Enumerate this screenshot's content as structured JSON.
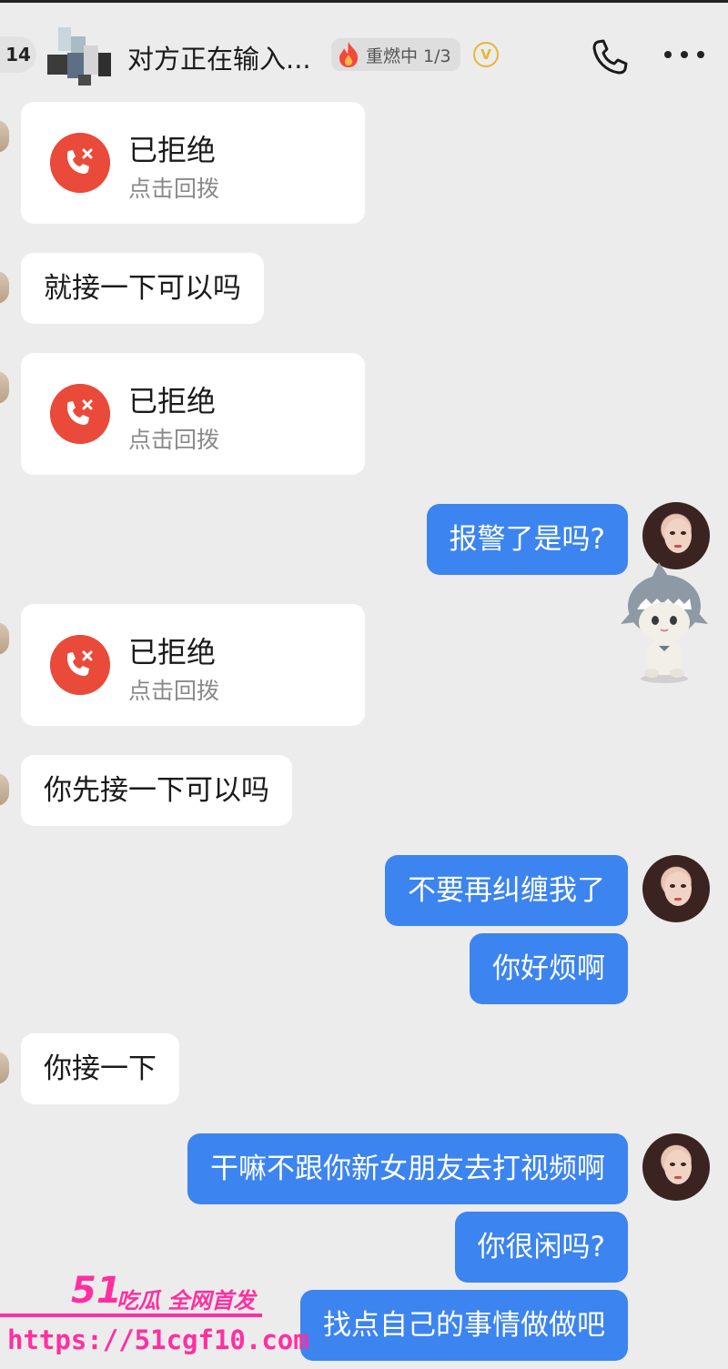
{
  "header": {
    "unread_count": "14",
    "typing_text": "对方正在输入...",
    "fire_tag": "重燃中 1/3",
    "vip_badge": "V",
    "phone_icon": "phone-icon",
    "more_icon": "more-icon"
  },
  "messages": [
    {
      "side": "left",
      "type": "call",
      "title": "已拒绝",
      "sub": "点击回拨"
    },
    {
      "side": "left",
      "type": "text",
      "text": "就接一下可以吗"
    },
    {
      "side": "left",
      "type": "call",
      "title": "已拒绝",
      "sub": "点击回拨"
    },
    {
      "side": "right",
      "type": "text",
      "text": "报警了是吗?"
    },
    {
      "side": "left",
      "type": "call",
      "title": "已拒绝",
      "sub": "点击回拨"
    },
    {
      "side": "left",
      "type": "text",
      "text": "你先接一下可以吗"
    },
    {
      "side": "right",
      "type": "text",
      "text": "不要再纠缠我了"
    },
    {
      "side": "right",
      "type": "text",
      "text": "你好烦啊"
    },
    {
      "side": "left",
      "type": "text",
      "text": "你接一下"
    },
    {
      "side": "right",
      "type": "text",
      "text": "干嘛不跟你新女朋友去打视频啊"
    },
    {
      "side": "right",
      "type": "text",
      "text": "你很闲吗?"
    },
    {
      "side": "right",
      "type": "text",
      "text": "找点自己的事情做做吧"
    }
  ],
  "watermark": {
    "brand_num": "51",
    "brand_text": "吃瓜 全网首发",
    "url": "https://51cgf10.com"
  },
  "colors": {
    "background": "#ececec",
    "sent_bubble": "#3c84ef",
    "received_bubble": "#ffffff",
    "declined_call": "#ea4a3a",
    "watermark": "#ff2fa0"
  }
}
